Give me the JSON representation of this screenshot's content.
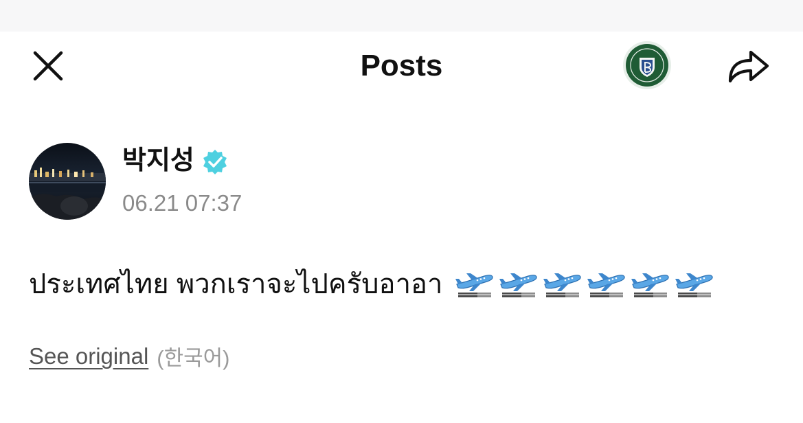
{
  "header": {
    "title": "Posts",
    "close_icon": "close-icon",
    "share_icon": "share-arrow-icon",
    "channel_logo_icon": "crest-logo-icon"
  },
  "post": {
    "author": "박지성",
    "verified_icon": "verified-badge-icon",
    "timestamp": "06.21 07:37",
    "text": "ประเทศไทย พวกเราจะไปครับอาอา",
    "emoji": [
      "airplane-departure-icon",
      "airplane-departure-icon",
      "airplane-departure-icon",
      "airplane-departure-icon",
      "airplane-departure-icon",
      "airplane-departure-icon"
    ]
  },
  "translation": {
    "link_label": "See original",
    "language_label": "(한국어)"
  },
  "colors": {
    "verified": "#4ed0e0",
    "timestamp": "#8a8a8a",
    "logo_green": "#1f5c35"
  }
}
